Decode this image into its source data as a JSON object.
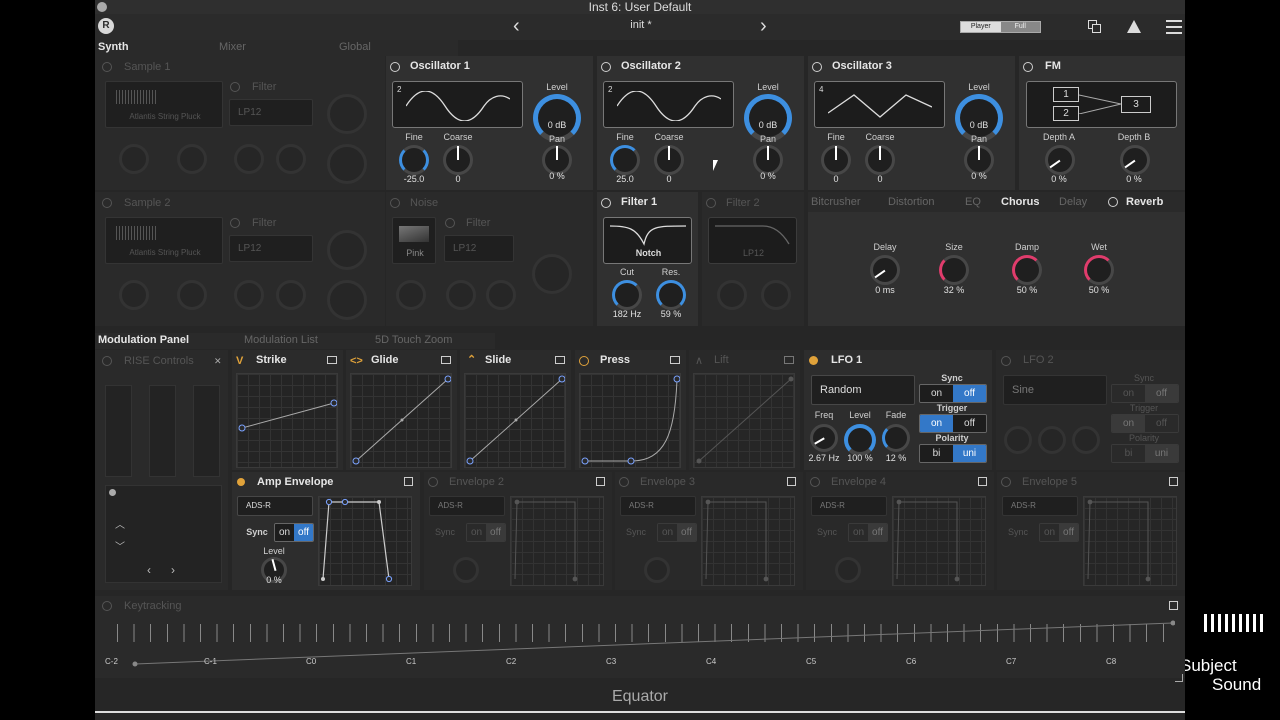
{
  "window": {
    "title": "Inst 6: User Default"
  },
  "topbar": {
    "preset": "init *",
    "prev_arrow": "‹",
    "next_arrow": "›",
    "mode_player": "Player",
    "mode_full": "Full"
  },
  "tabs": {
    "synth": "Synth",
    "mixer": "Mixer",
    "global": "Global"
  },
  "sample1": {
    "title": "Sample 1",
    "sample_name": "Atlantis String Pluck",
    "filter_title": "Filter",
    "filter_type": "LP12"
  },
  "sample2": {
    "title": "Sample 2",
    "sample_name": "Atlantis String Pluck",
    "filter_title": "Filter",
    "filter_type": "LP12"
  },
  "noise": {
    "title": "Noise",
    "color": "Pink",
    "filter_title": "Filter",
    "filter_type": "LP12"
  },
  "osc1": {
    "title": "Oscillator 1",
    "wave_num": "2",
    "level_label": "Level",
    "level": "0 dB",
    "fine_label": "Fine",
    "fine": "-25.0",
    "coarse_label": "Coarse",
    "coarse": "0",
    "pan_label": "Pan",
    "pan": "0 %"
  },
  "osc2": {
    "title": "Oscillator 2",
    "wave_num": "2",
    "level_label": "Level",
    "level": "0 dB",
    "fine_label": "Fine",
    "fine": "25.0",
    "coarse_label": "Coarse",
    "coarse": "0",
    "pan_label": "Pan",
    "pan": "0 %"
  },
  "osc3": {
    "title": "Oscillator 3",
    "wave_num": "4",
    "level_label": "Level",
    "level": "0 dB",
    "fine_label": "Fine",
    "fine": "0",
    "coarse_label": "Coarse",
    "coarse": "0",
    "pan_label": "Pan",
    "pan": "0 %"
  },
  "fm": {
    "title": "FM",
    "n1": "1",
    "n2": "2",
    "n3": "3",
    "depth_a_label": "Depth A",
    "depth_a": "0 %",
    "depth_b_label": "Depth B",
    "depth_b": "0 %"
  },
  "filter1": {
    "title": "Filter 1",
    "type": "Notch",
    "cut_label": "Cut",
    "cut": "182 Hz",
    "res_label": "Res.",
    "res": "59 %"
  },
  "filter2": {
    "title": "Filter 2",
    "type": "LP12"
  },
  "fx": {
    "tabs": [
      "Bitcrusher",
      "Distortion",
      "EQ",
      "Chorus",
      "Delay",
      "Reverb"
    ],
    "delay_label": "Delay",
    "delay": "0 ms",
    "size_label": "Size",
    "size": "32 %",
    "damp_label": "Damp",
    "damp": "50 %",
    "wet_label": "Wet",
    "wet": "50 %"
  },
  "modtabs": {
    "panel": "Modulation Panel",
    "list": "Modulation List",
    "touch": "5D Touch Zoom"
  },
  "rise": {
    "title": "RISE Controls"
  },
  "strike": {
    "title": "Strike"
  },
  "glide": {
    "title": "Glide"
  },
  "slide": {
    "title": "Slide"
  },
  "press": {
    "title": "Press"
  },
  "lift": {
    "title": "Lift"
  },
  "lfo1": {
    "title": "LFO 1",
    "shape": "Random",
    "sync_label": "Sync",
    "trigger_label": "Trigger",
    "polarity_label": "Polarity",
    "on": "on",
    "off": "off",
    "bi": "bi",
    "uni": "uni",
    "freq_label": "Freq",
    "freq": "2.67 Hz",
    "level_label": "Level",
    "level": "100 %",
    "fade_label": "Fade",
    "fade": "12 %"
  },
  "lfo2": {
    "title": "LFO 2",
    "shape": "Sine",
    "sync_label": "Sync",
    "trigger_label": "Trigger",
    "polarity_label": "Polarity",
    "on": "on",
    "off": "off",
    "bi": "bi",
    "uni": "uni"
  },
  "amp": {
    "title": "Amp Envelope",
    "mode": "ADS-R",
    "sync_label": "Sync",
    "on": "on",
    "off": "off",
    "level_label": "Level",
    "level": "0 %"
  },
  "env2": {
    "title": "Envelope 2",
    "mode": "ADS-R",
    "sync_label": "Sync",
    "on": "on",
    "off": "off"
  },
  "env3": {
    "title": "Envelope 3",
    "mode": "ADS-R",
    "sync_label": "Sync",
    "on": "on",
    "off": "off"
  },
  "env4": {
    "title": "Envelope 4",
    "mode": "ADS-R",
    "sync_label": "Sync",
    "on": "on",
    "off": "off"
  },
  "env5": {
    "title": "Envelope 5",
    "mode": "ADS-R",
    "sync_label": "Sync",
    "on": "on",
    "off": "off"
  },
  "keytracking": {
    "title": "Keytracking",
    "notes": [
      "C-2",
      "C-1",
      "C0",
      "C1",
      "C2",
      "C3",
      "C4",
      "C5",
      "C6",
      "C7",
      "C8"
    ]
  },
  "footer": {
    "name": "Equator"
  },
  "watermark": {
    "line1": "Subject",
    "line2": "Sound"
  }
}
